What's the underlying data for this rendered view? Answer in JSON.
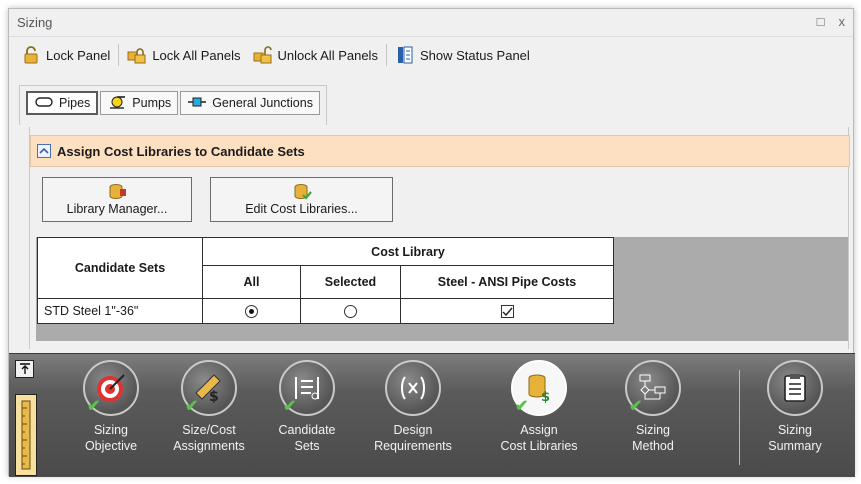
{
  "window": {
    "title": "Sizing",
    "restore_icon": "□",
    "close_icon": "x"
  },
  "toolbar": {
    "lock_panel": "Lock Panel",
    "lock_all": "Lock All Panels",
    "unlock_all": "Unlock All Panels",
    "show_status": "Show Status Panel"
  },
  "tabs": [
    {
      "label": "Pipes",
      "icon": "pipe-icon",
      "active": true
    },
    {
      "label": "Pumps",
      "icon": "pump-icon",
      "active": false
    },
    {
      "label": "General Junctions",
      "icon": "junction-icon",
      "active": false
    }
  ],
  "section": {
    "title": "Assign Cost Libraries to Candidate Sets"
  },
  "buttons": {
    "library_manager": "Library Manager...",
    "edit_cost_libraries": "Edit Cost Libraries..."
  },
  "grid": {
    "candidate_sets_header": "Candidate Sets",
    "cost_library_header": "Cost Library",
    "columns": [
      "All",
      "Selected",
      "Steel - ANSI Pipe Costs"
    ],
    "rows": [
      {
        "name": "STD Steel 1\"-36\"",
        "all": true,
        "selected": false,
        "steel_ansi": true
      }
    ]
  },
  "steps": [
    {
      "line1": "Sizing",
      "line2": "Objective",
      "icon": "target-icon",
      "active": false
    },
    {
      "line1": "Size/Cost",
      "line2": "Assignments",
      "icon": "ruler-dollar-icon",
      "active": false
    },
    {
      "line1": "Candidate",
      "line2": "Sets",
      "icon": "list-icon",
      "active": false
    },
    {
      "line1": "Design",
      "line2": "Requirements",
      "icon": "variable-icon",
      "active": false
    },
    {
      "line1": "Assign",
      "line2": "Cost Libraries",
      "icon": "database-dollar-icon",
      "active": true
    },
    {
      "line1": "Sizing",
      "line2": "Method",
      "icon": "flowchart-icon",
      "active": false
    },
    {
      "line1": "Sizing",
      "line2": "Summary",
      "icon": "clipboard-icon",
      "active": false
    }
  ],
  "colors": {
    "accent_header": "#fde0c2",
    "bottom_bar": "#5b5b5b",
    "check_green": "#5ac24a"
  }
}
